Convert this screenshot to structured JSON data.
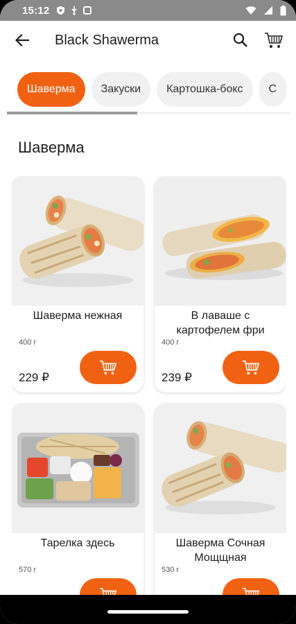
{
  "status_bar": {
    "time": "15:12",
    "icons": [
      "shield-icon",
      "usb-icon",
      "notification-icon"
    ],
    "right_icons": [
      "wifi-icon",
      "signal-icon",
      "battery-icon"
    ]
  },
  "app_bar": {
    "title": "Black Shawerma",
    "back_icon": "arrow-left-icon",
    "search_icon": "search-icon",
    "cart_icon": "cart-icon"
  },
  "tabs": [
    {
      "label": "Шаверма",
      "active": true
    },
    {
      "label": "Закуски",
      "active": false
    },
    {
      "label": "Картошка-бокс",
      "active": false
    },
    {
      "label": "С",
      "active": false
    }
  ],
  "section_title": "Шаверма",
  "products": [
    {
      "name": "Шаверма нежная",
      "weight": "400 г",
      "price": "229 ₽",
      "image": "shawarma-wrap-halves"
    },
    {
      "name": "В лаваше с картофелем фри",
      "weight": "400 г",
      "price": "239 ₽",
      "image": "shawarma-with-fries"
    },
    {
      "name": "Тарелка здесь",
      "weight": "570 г",
      "price": "",
      "image": "shawarma-plate-tray"
    },
    {
      "name": "Шаверма Сочная Мощщная",
      "weight": "530 г",
      "price": "",
      "image": "shawarma-juicy-halves"
    }
  ],
  "colors": {
    "accent": "#f06212",
    "status_bar": "#8a8a8a"
  }
}
